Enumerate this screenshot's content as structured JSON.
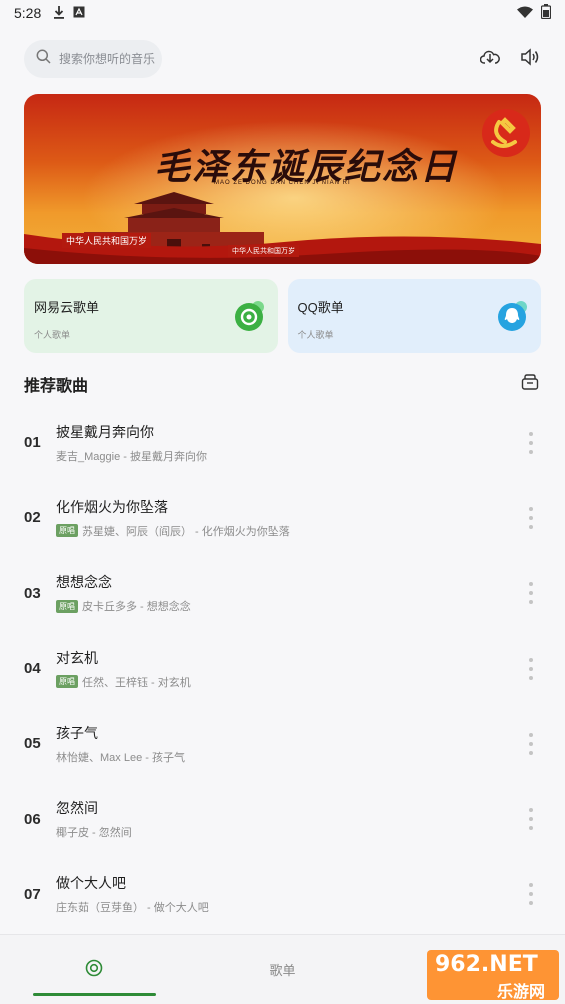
{
  "status_bar": {
    "time": "5:28"
  },
  "search": {
    "placeholder": "搜索你想听的音乐"
  },
  "banner": {
    "title": "毛泽东诞辰纪念日",
    "subtitle": "MAO ZE DONG DAN CHEN JI NIAN RI",
    "slogan_left": "中华人民共和国万岁",
    "slogan_right": "中华人民共和国万岁"
  },
  "playlists": [
    {
      "title": "网易云歌单",
      "sub": "个人歌单",
      "accent": "#3cb043"
    },
    {
      "title": "QQ歌单",
      "sub": "个人歌单",
      "accent": "#26a3e0"
    }
  ],
  "section": {
    "title": "推荐歌曲"
  },
  "songs": [
    {
      "index": "01",
      "title": "披星戴月奔向你",
      "meta": "麦吉_Maggie - 披星戴月奔向你",
      "badge": ""
    },
    {
      "index": "02",
      "title": "化作烟火为你坠落",
      "meta": "苏星婕、阿辰（阎辰） - 化作烟火为你坠落",
      "badge": "原唱"
    },
    {
      "index": "03",
      "title": "想想念念",
      "meta": "皮卡丘多多 - 想想念念",
      "badge": "原唱"
    },
    {
      "index": "04",
      "title": "对玄机",
      "meta": "任然、王梓钰 - 对玄机",
      "badge": "原唱"
    },
    {
      "index": "05",
      "title": "孩子气",
      "meta": "林怡婕、Max Lee - 孩子气",
      "badge": ""
    },
    {
      "index": "06",
      "title": "忽然间",
      "meta": "椰子皮 - 忽然间",
      "badge": ""
    },
    {
      "index": "07",
      "title": "做个大人吧",
      "meta": "庄东茹（豆芽鱼） - 做个大人吧",
      "badge": ""
    }
  ],
  "bottom_nav": {
    "tab2_label": "歌单"
  },
  "watermark": {
    "top": "962.NET",
    "bottom": "乐游网"
  },
  "colors": {
    "accent": "#2e8b37",
    "badge": "#6ca062"
  }
}
